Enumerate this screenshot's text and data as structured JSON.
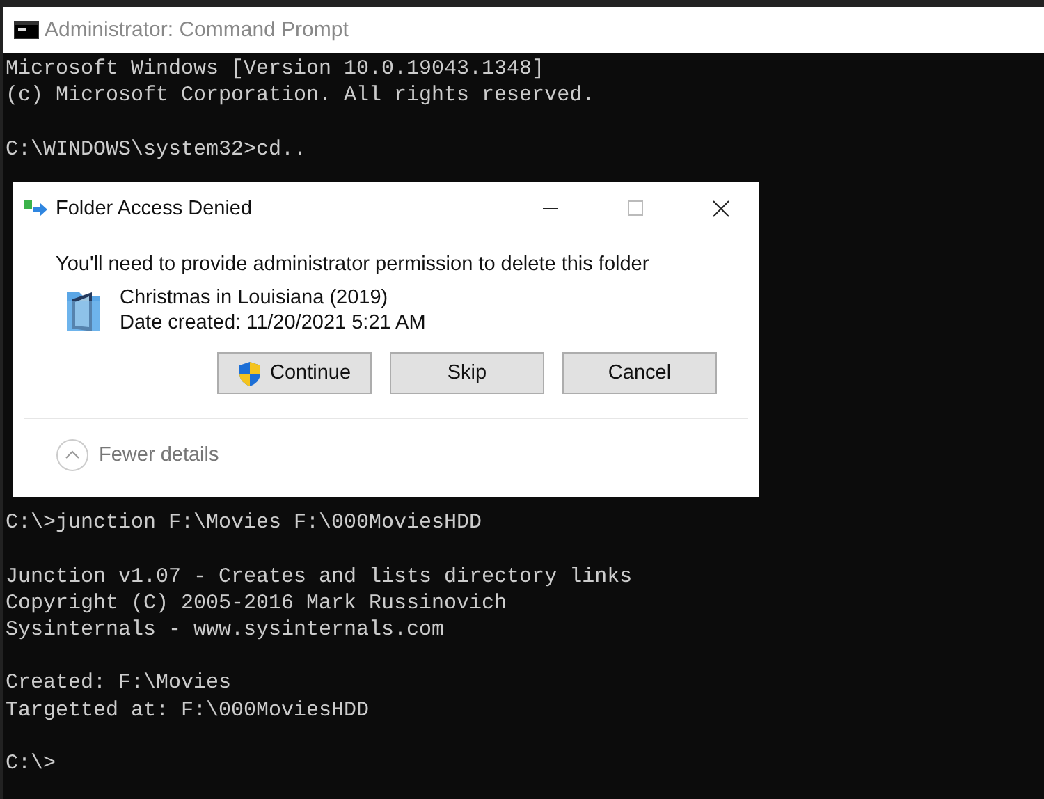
{
  "window": {
    "title": "Administrator: Command Prompt"
  },
  "console": {
    "lines": [
      {
        "kind": "text",
        "text": "Microsoft Windows [Version 10.0.19043.1348]"
      },
      {
        "kind": "text",
        "text": "(c) Microsoft Corporation. All rights reserved."
      },
      {
        "kind": "blank"
      },
      {
        "kind": "text",
        "text": "C:\\WINDOWS\\system32>cd.."
      },
      {
        "kind": "blank"
      },
      {
        "kind": "blank"
      },
      {
        "kind": "blank"
      },
      {
        "kind": "blank"
      },
      {
        "kind": "blank"
      },
      {
        "kind": "blank"
      },
      {
        "kind": "blank"
      },
      {
        "kind": "blank"
      },
      {
        "kind": "blank"
      },
      {
        "kind": "blank"
      },
      {
        "kind": "blank"
      },
      {
        "kind": "blank"
      },
      {
        "kind": "blank"
      },
      {
        "kind": "text",
        "text": "C:\\>junction F:\\Movies F:\\000MoviesHDD"
      },
      {
        "kind": "blank"
      },
      {
        "kind": "text",
        "text": "Junction v1.07 - Creates and lists directory links"
      },
      {
        "kind": "text",
        "text": "Copyright (C) 2005-2016 Mark Russinovich"
      },
      {
        "kind": "text",
        "text": "Sysinternals - www.sysinternals.com"
      },
      {
        "kind": "blank"
      },
      {
        "kind": "text",
        "text": "Created: F:\\Movies"
      },
      {
        "kind": "text",
        "text": "Targetted at: F:\\000MoviesHDD"
      },
      {
        "kind": "blank"
      },
      {
        "kind": "text",
        "text": "C:\\>"
      }
    ]
  },
  "dialog": {
    "title": "Folder Access Denied",
    "message": "You'll need to provide administrator permission to delete this folder",
    "item": {
      "name": "Christmas in Louisiana (2019)",
      "date": "Date created: 11/20/2021 5:21 AM"
    },
    "buttons": [
      {
        "label": "Continue",
        "shield": true
      },
      {
        "label": "Skip",
        "shield": false
      },
      {
        "label": "Cancel",
        "shield": false
      }
    ],
    "details": {
      "label": "Fewer details",
      "expanded": true
    }
  }
}
